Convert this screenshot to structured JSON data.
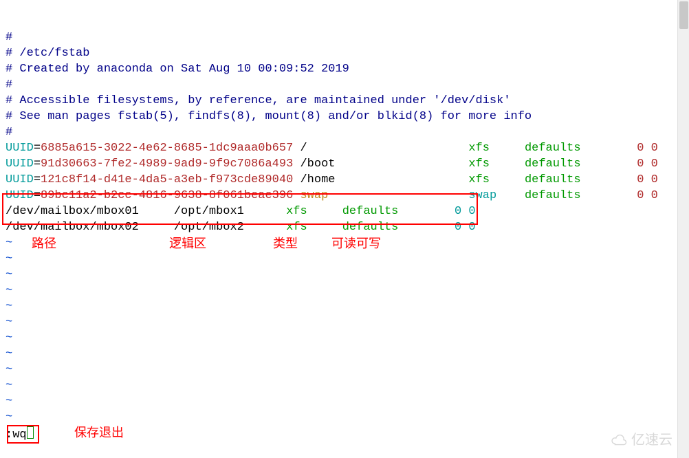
{
  "comments": [
    "#",
    "# /etc/fstab",
    "# Created by anaconda on Sat Aug 10 00:09:52 2019",
    "#",
    "# Accessible filesystems, by reference, are maintained under '/dev/disk'",
    "# See man pages fstab(5), findfs(8), mount(8) and/or blkid(8) for more info",
    "#"
  ],
  "entries": [
    {
      "key": "UUID",
      "val": "6885a615-3022-4e62-8685-1dc9aaa0b657",
      "mount": "/",
      "fs": "xfs",
      "opts": "defaults",
      "d": "0",
      "p": "0"
    },
    {
      "key": "UUID",
      "val": "91d30663-7fe2-4989-9ad9-9f9c7086a493",
      "mount": "/boot",
      "fs": "xfs",
      "opts": "defaults",
      "d": "0",
      "p": "0"
    },
    {
      "key": "UUID",
      "val": "121c8f14-d41e-4da5-a3eb-f973cde89040",
      "mount": "/home",
      "fs": "xfs",
      "opts": "defaults",
      "d": "0",
      "p": "0"
    },
    {
      "key": "UUID",
      "val": "89bc11a2-b2cc-4816-9638-8f061beae396",
      "mount": "swap",
      "fs": "swap",
      "opts": "defaults",
      "d": "0",
      "p": "0"
    }
  ],
  "custom": [
    {
      "dev": "/dev/mailbox/mbox01",
      "mount": "/opt/mbox1",
      "fs": "xfs",
      "opts": "defaults",
      "d": "0",
      "p": "0"
    },
    {
      "dev": "/dev/mailbox/mbox02",
      "mount": "/opt/mbox2",
      "fs": "xfs",
      "opts": "defaults",
      "d": "0",
      "p": "0"
    }
  ],
  "tilde": "~",
  "cmd": {
    "colon": ":",
    "text": "wq"
  },
  "annotations": {
    "path": "路径",
    "logic": "逻辑区",
    "type": "类型",
    "rw": "可读可写",
    "save": "保存退出"
  },
  "watermark": "亿速云"
}
